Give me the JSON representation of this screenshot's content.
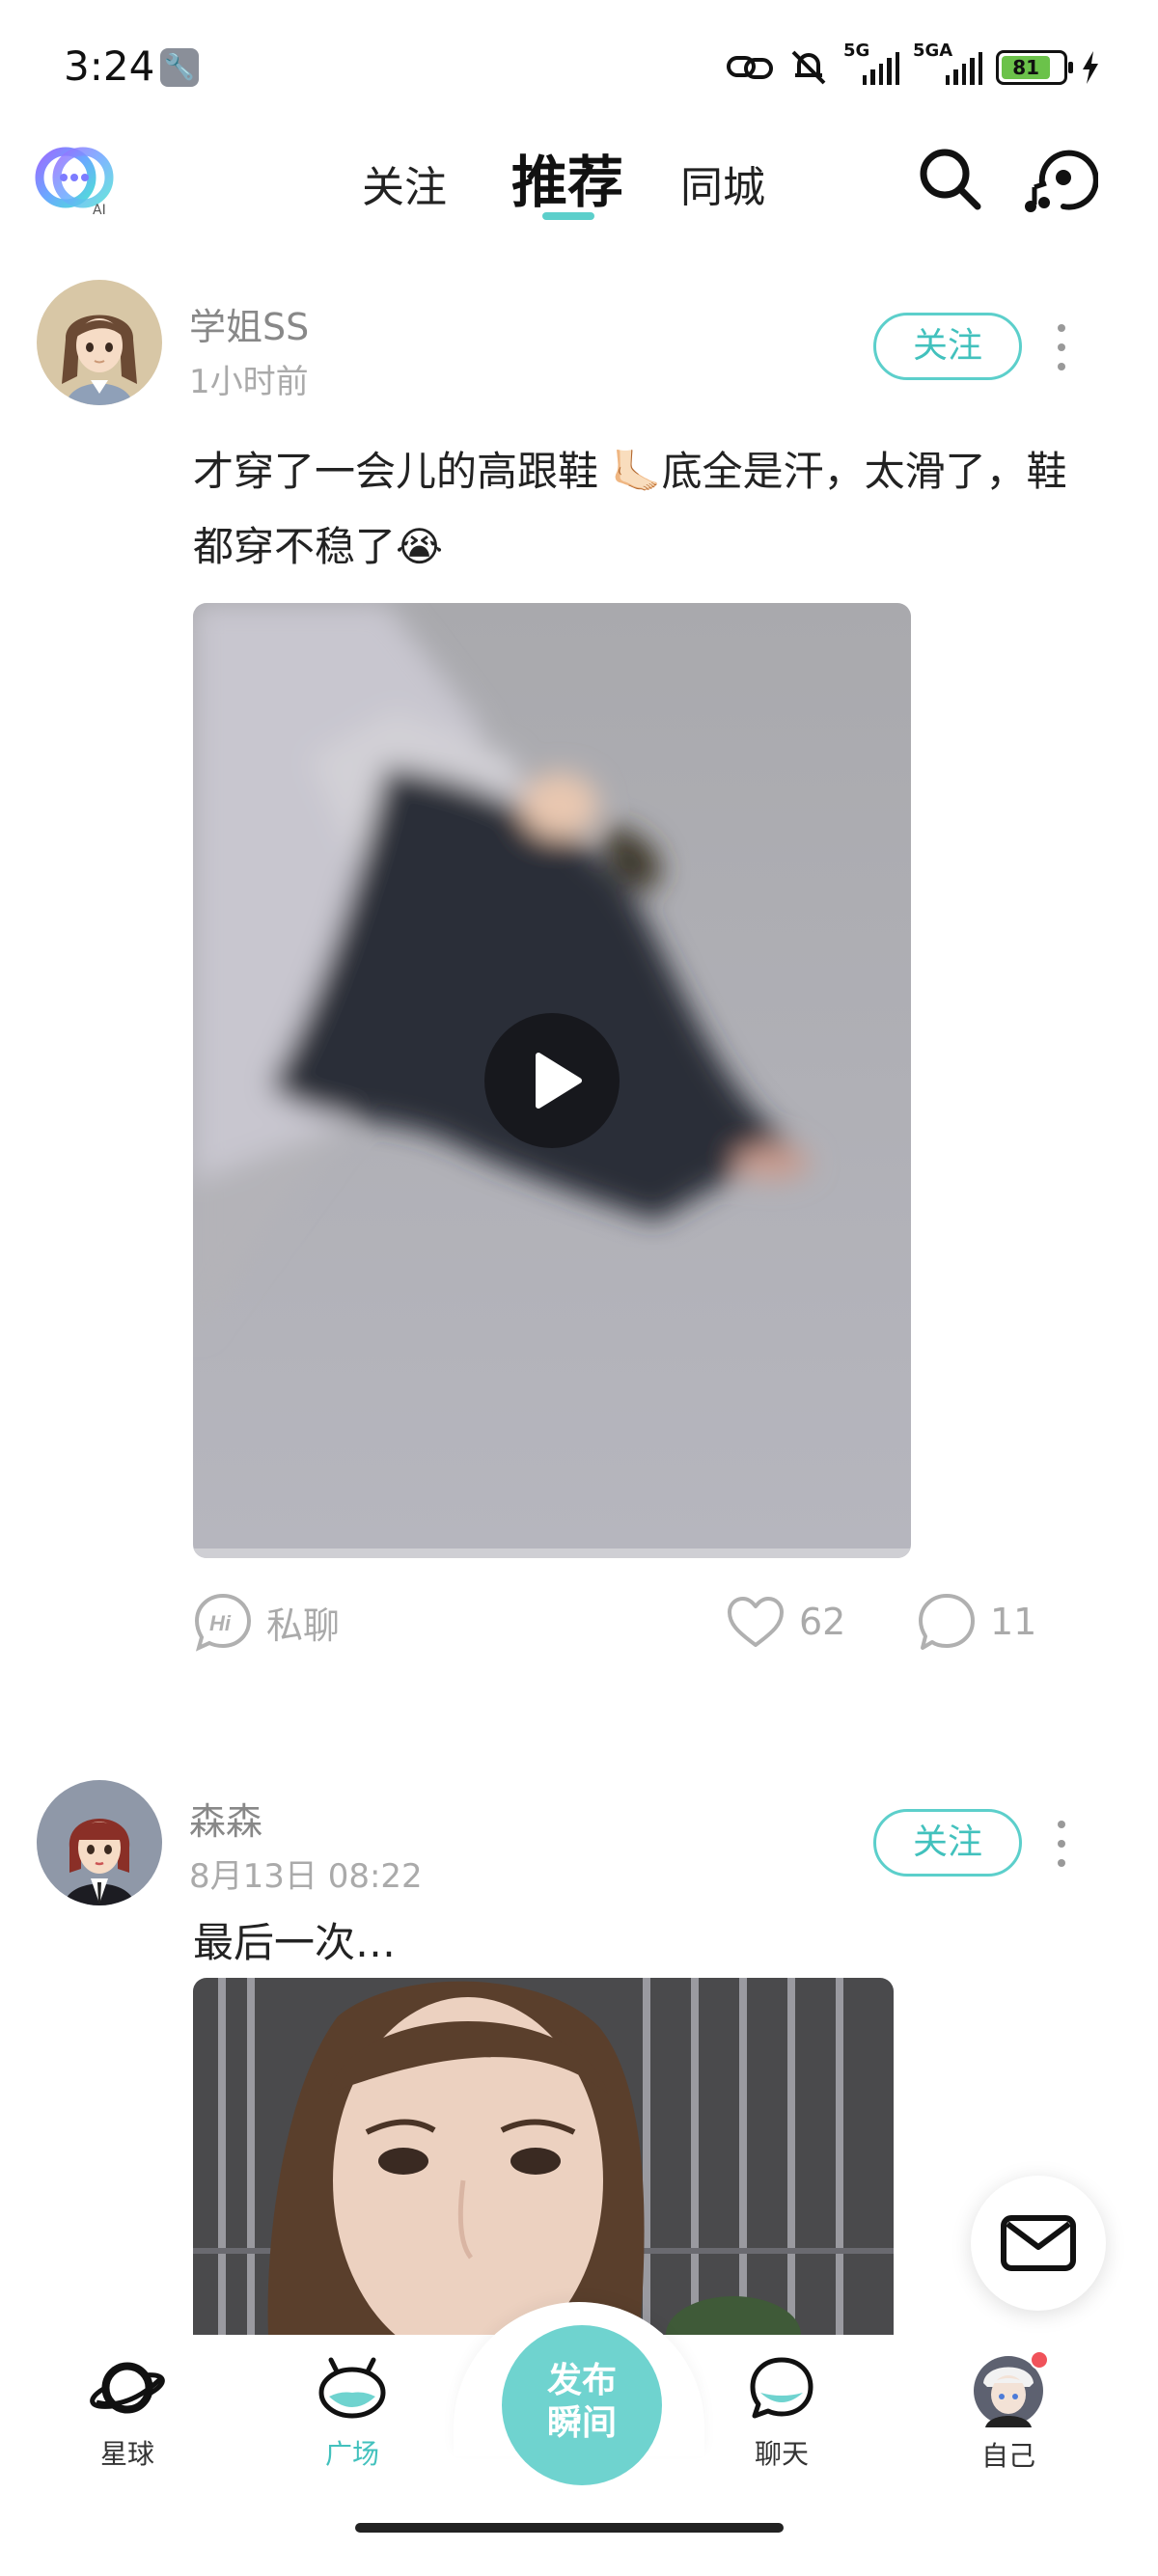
{
  "status_bar": {
    "time": "3:24",
    "network_1": "5G",
    "network_2": "5GA",
    "battery": "81",
    "battery_level": 0.81
  },
  "header": {
    "tabs": [
      {
        "label": "关注",
        "active": false
      },
      {
        "label": "推荐",
        "active": true
      },
      {
        "label": "同城",
        "active": false
      }
    ],
    "logo_badge": "AI",
    "icons": [
      "app-logo-icon",
      "search-icon",
      "music-search-icon"
    ]
  },
  "posts": [
    {
      "username": "学姐SS",
      "time": "1小时前",
      "follow_label": "关注",
      "text": "才穿了一会儿的高跟鞋 🦶🏻底全是汗，太滑了，鞋都穿不稳了😭",
      "media_type": "video",
      "private_chat_label": "私聊",
      "likes": "62",
      "comments": "11"
    },
    {
      "username": "森森",
      "time": "8月13日 08:22",
      "follow_label": "关注",
      "text": "最后一次…",
      "media_type": "image"
    }
  ],
  "bottom_nav": {
    "items": [
      {
        "label": "星球",
        "icon": "planet-icon",
        "active": false
      },
      {
        "label": "广场",
        "icon": "square-icon",
        "active": true
      },
      {
        "label": "聊天",
        "icon": "chat-icon",
        "active": false
      },
      {
        "label": "自己",
        "icon": "profile-avatar",
        "active": false
      }
    ],
    "publish_line1": "发布",
    "publish_line2": "瞬间"
  },
  "colors": {
    "accent": "#5ccfcb",
    "accent_text": "#42c1bd",
    "notification_dot": "#f0525a"
  }
}
